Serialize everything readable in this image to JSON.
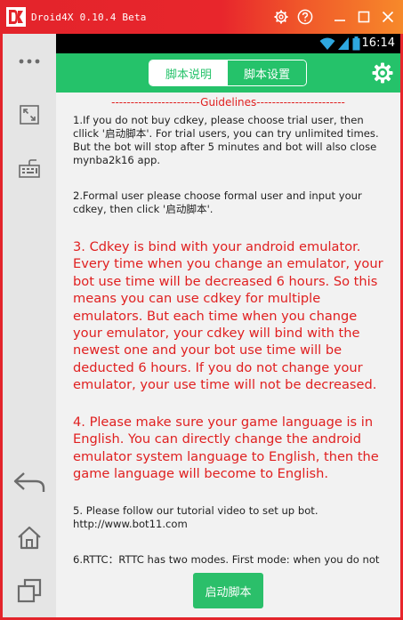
{
  "window": {
    "title": "Droid4X 0.10.4 Beta",
    "accent": "#e3242b",
    "accent_secondary": "#f7892a"
  },
  "status_bar": {
    "time": "16:14",
    "icons": [
      "wifi-icon",
      "signal-icon",
      "battery-icon"
    ]
  },
  "header": {
    "tabs": [
      {
        "label": "脚本说明",
        "active": true
      },
      {
        "label": "脚本设置",
        "active": false
      }
    ],
    "color": "#25c26a"
  },
  "content": {
    "guidelines_header": "-----------------------Guidelines-----------------------",
    "paragraphs": [
      "1.If you do not  buy cdkey, please choose trial user, then cllick '启动脚本'. For trial users, you can try unlimited times. But the bot will stop after 5 minutes and bot will also close mynba2k16 app.",
      "2.Formal user please choose formal user and input your cdkey, then click '启动脚本'.",
      "3. Cdkey is bind with your android emulator. Every time when you change an emulator,  your bot use time will be decreased 6 hours.  So this means you can use cdkey for multiple emulators. But each time when you change your emulator, your cdkey will bind with the newest one and your bot use time will be deducted 6 hours. If you do not change your emulator, your use time will not be decreased.",
      "4. Please make sure your game language is in English. You can directly change the android emulator system language to English, then the game language will become to English.",
      "5. Please follow our tutorial video to set up bot.  http://www.bot11.com",
      "6.RTTC：RTTC has two modes. First mode: when you do not"
    ],
    "highlight_color": "#e02020"
  },
  "footer": {
    "start_button": "启动脚本"
  }
}
